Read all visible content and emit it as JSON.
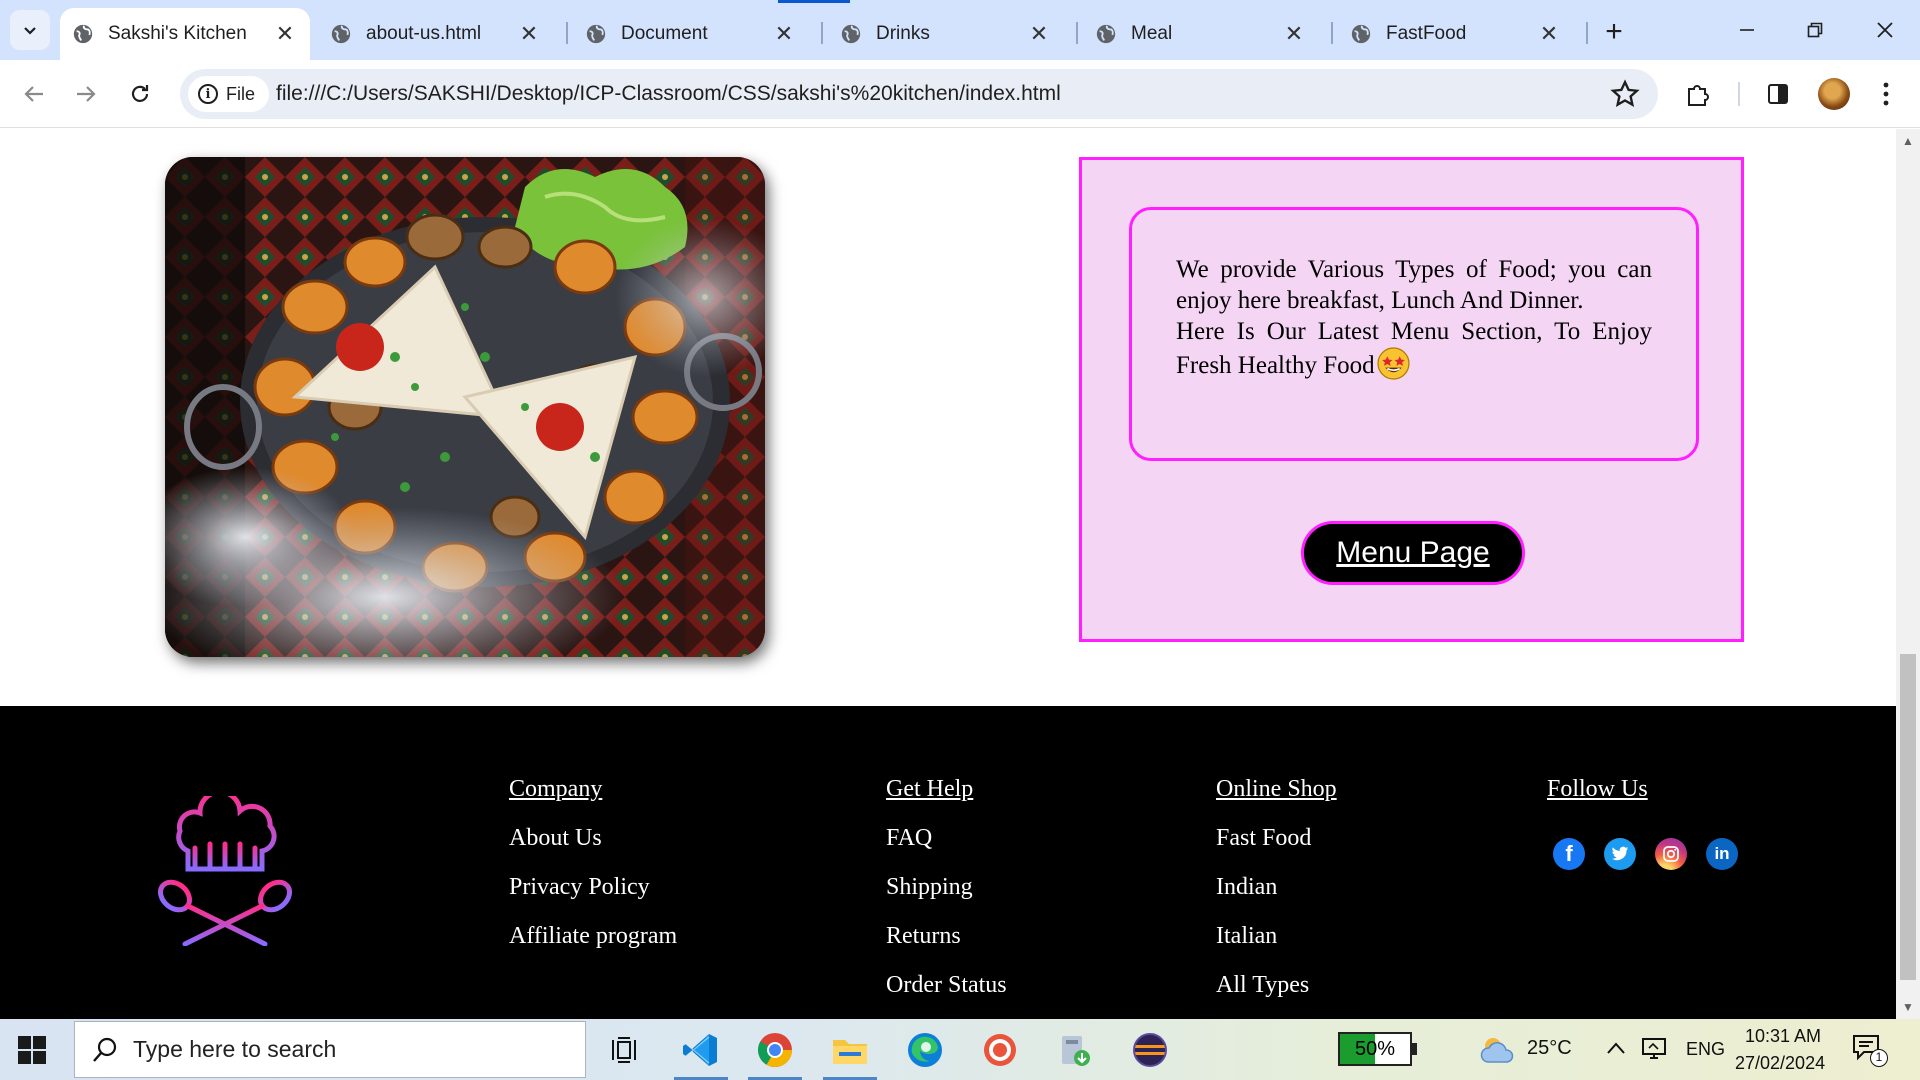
{
  "browser": {
    "tabs": [
      {
        "label": "Sakshi's Kitchen",
        "active": true
      },
      {
        "label": "about-us.html",
        "active": false
      },
      {
        "label": "Document",
        "active": false
      },
      {
        "label": "Drinks",
        "active": false
      },
      {
        "label": "Meal",
        "active": false
      },
      {
        "label": "FastFood",
        "active": false
      }
    ],
    "new_tab": "+",
    "address": {
      "chip_label": "File",
      "url": "file:///C:/Users/SAKSHI/Desktop/ICP-Classroom/CSS/sakshi's%20kitchen/index.html"
    }
  },
  "page": {
    "image_icon": "food-platter-photo",
    "about_text_1": "We provide Various Types of Food; you can enjoy here breakfast, Lunch And Dinner.",
    "about_text_2": "Here Is Our Latest Menu Section, To Enjoy Fresh Healthy Food",
    "emoji_icon": "star-struck-emoji",
    "menu_button": "Menu Page",
    "accent_color": "#ff1fff",
    "panel_color": "#f4d5f4"
  },
  "footer": {
    "logo_icon": "chef-hat-logo",
    "columns": [
      {
        "heading": "Company",
        "items": [
          "About Us",
          "Privacy Policy",
          "Affiliate program"
        ]
      },
      {
        "heading": "Get Help",
        "items": [
          "FAQ",
          "Shipping",
          "Returns",
          "Order Status"
        ]
      },
      {
        "heading": "Online Shop",
        "items": [
          "Fast Food",
          "Indian",
          "Italian",
          "All Types"
        ]
      },
      {
        "heading": "Follow Us",
        "items": []
      }
    ],
    "social": [
      "facebook-icon",
      "twitter-icon",
      "instagram-icon",
      "linkedin-icon"
    ]
  },
  "taskbar": {
    "search_placeholder": "Type here to search",
    "battery_percent": "50%",
    "battery_level": 0.5,
    "temperature": "25°C",
    "language": "ENG",
    "time": "10:31 AM",
    "date": "27/02/2024",
    "notification_count": "1"
  }
}
